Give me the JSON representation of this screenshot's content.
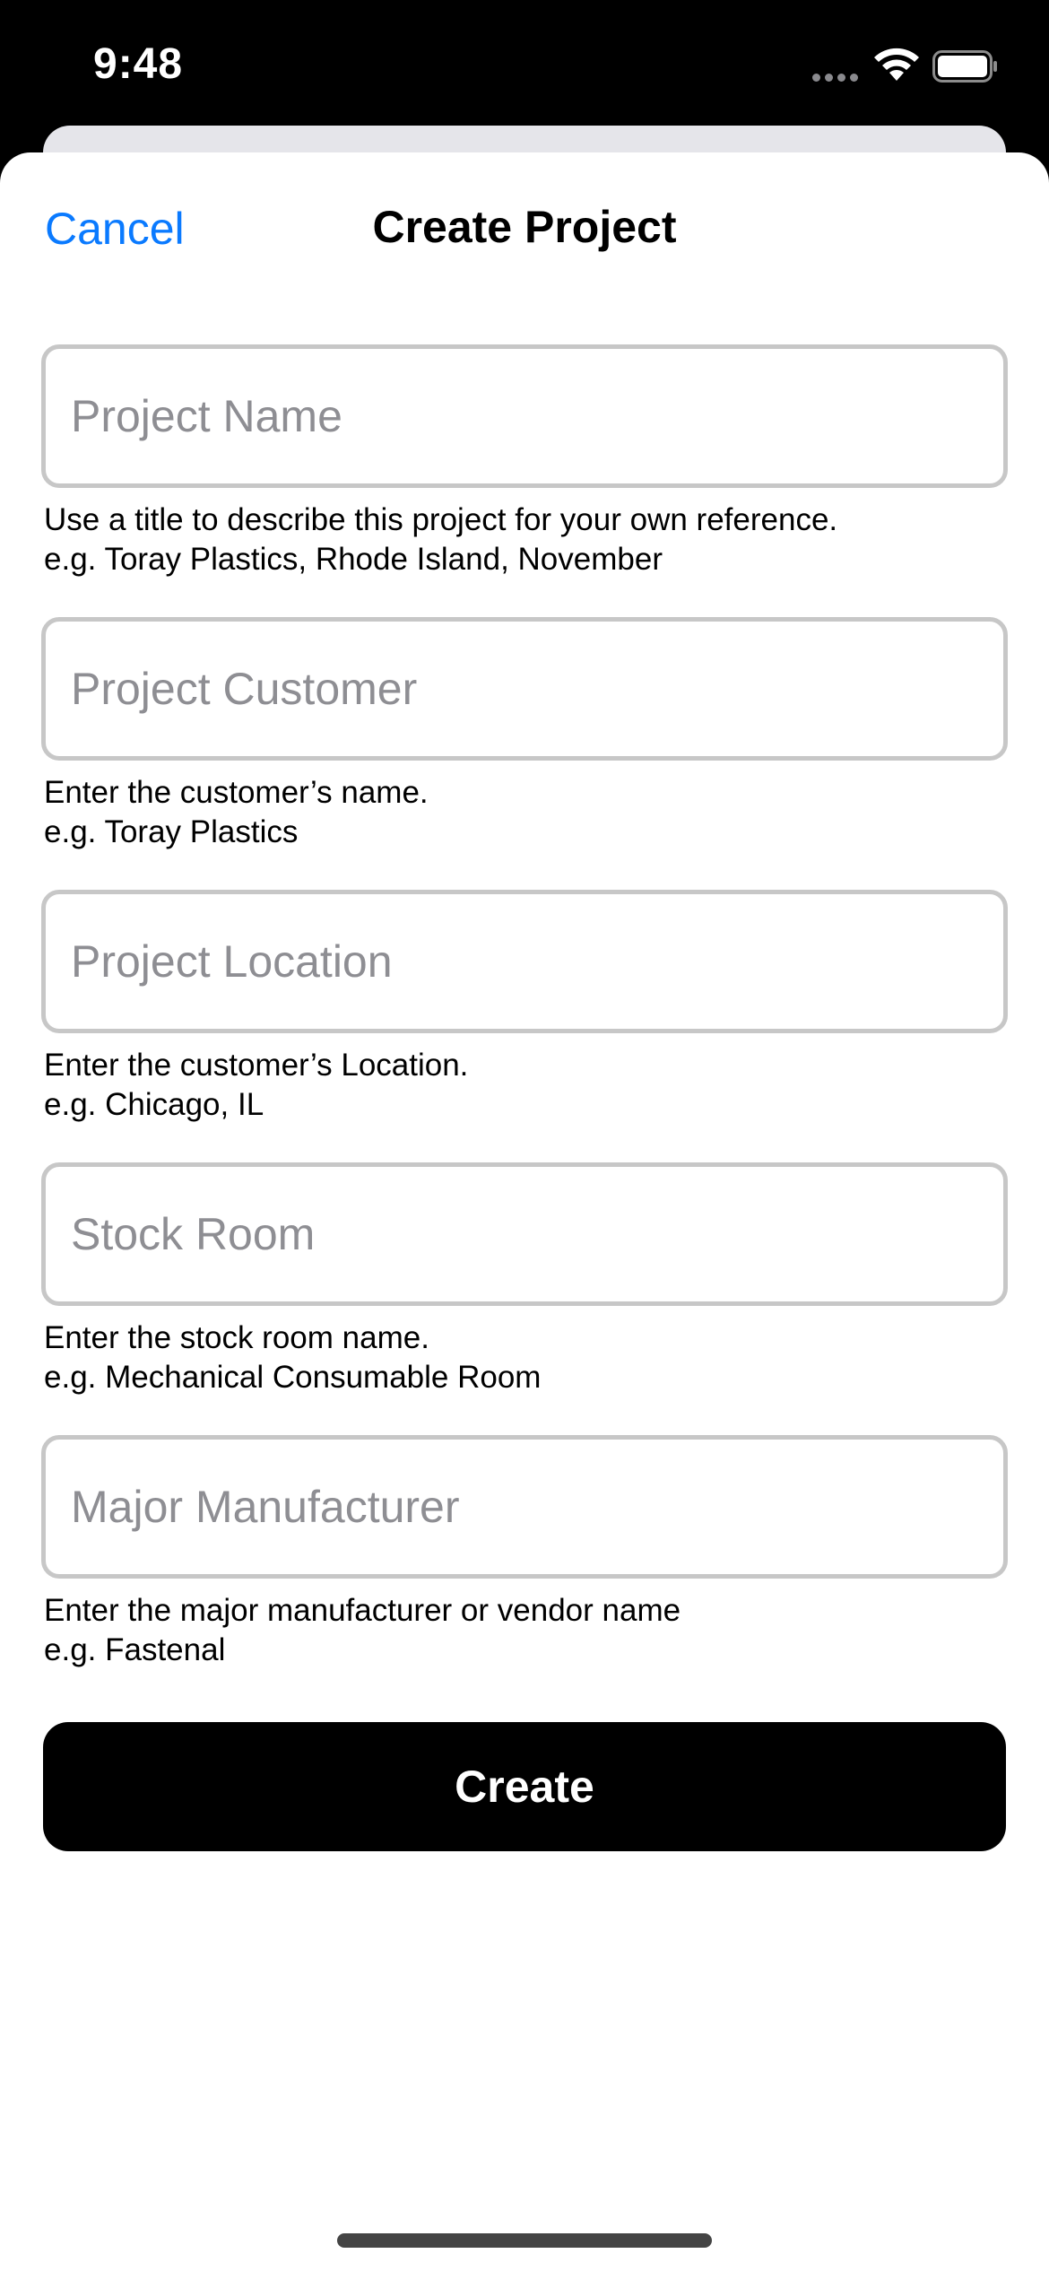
{
  "status_bar": {
    "time": "9:48",
    "icons": [
      "signal-dots-icon",
      "wifi-icon",
      "battery-icon"
    ]
  },
  "nav": {
    "cancel_label": "Cancel",
    "title": "Create Project"
  },
  "fields": [
    {
      "placeholder": "Project Name",
      "value": "",
      "helper_line1": "Use a title to describe this project for your own reference.",
      "helper_line2": "e.g. Toray Plastics, Rhode Island, November"
    },
    {
      "placeholder": "Project Customer",
      "value": "",
      "helper_line1": "Enter the customer’s name.",
      "helper_line2": "e.g. Toray Plastics"
    },
    {
      "placeholder": "Project Location",
      "value": "",
      "helper_line1": "Enter the customer’s Location.",
      "helper_line2": "e.g. Chicago, IL"
    },
    {
      "placeholder": "Stock Room",
      "value": "",
      "helper_line1": "Enter the stock room name.",
      "helper_line2": "e.g. Mechanical Consumable Room"
    },
    {
      "placeholder": "Major Manufacturer",
      "value": "",
      "helper_line1": "Enter the major manufacturer or vendor name",
      "helper_line2": "e.g. Fastenal"
    }
  ],
  "create_label": "Create",
  "colors": {
    "accent": "#0a7aff",
    "button_bg": "#000000",
    "button_text": "#ffffff",
    "field_border": "#c7c7c7",
    "placeholder": "#8e8e93"
  }
}
